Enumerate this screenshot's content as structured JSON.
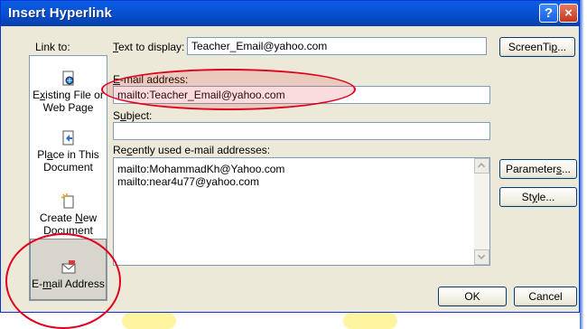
{
  "dialog": {
    "title": "Insert Hyperlink",
    "help_glyph": "?",
    "close_glyph": "×"
  },
  "link_to_label": "Link to:",
  "text_to_display": {
    "label_prefix": "",
    "label_underline": "T",
    "label_rest": "ext to display:",
    "value": "Teacher_Email@yahoo.com"
  },
  "screentip_button": {
    "pre": "ScreenTi",
    "underline": "p",
    "post": "..."
  },
  "email_address": {
    "label_underline": "E",
    "label_rest": "-mail address:",
    "value": "mailto:Teacher_Email@yahoo.com"
  },
  "subject": {
    "label_pre": "S",
    "label_underline": "u",
    "label_rest": "bject:",
    "value": ""
  },
  "recent": {
    "label_pre": "Re",
    "label_underline": "c",
    "label_rest": "ently used e-mail addresses:",
    "items": [
      "mailto:MohammadKh@Yahoo.com",
      "mailto:near4u77@yahoo.com"
    ]
  },
  "parameters_button": {
    "pre": "Parameter",
    "underline": "s",
    "post": "..."
  },
  "style_button": {
    "pre": "St",
    "underline": "y",
    "post": "le..."
  },
  "ok_button": "OK",
  "cancel_button": "Cancel",
  "link_bar": {
    "existing": {
      "line1_pre": "E",
      "line1_u": "x",
      "line1_post": "isting File or",
      "line2": "Web Page"
    },
    "place": {
      "line1_pre": "Pl",
      "line1_u": "a",
      "line1_post": "ce in This",
      "line2": "Document"
    },
    "create": {
      "line1": "Create ",
      "line1_u": "N",
      "line1_post": "ew",
      "line2": "Document"
    },
    "email": {
      "pre": "E-",
      "u": "m",
      "post": "ail Address"
    }
  },
  "colors": {
    "title_bar": "#0a54d8",
    "dialog_bg": "#ece9d8",
    "annotation": "#e00020"
  }
}
